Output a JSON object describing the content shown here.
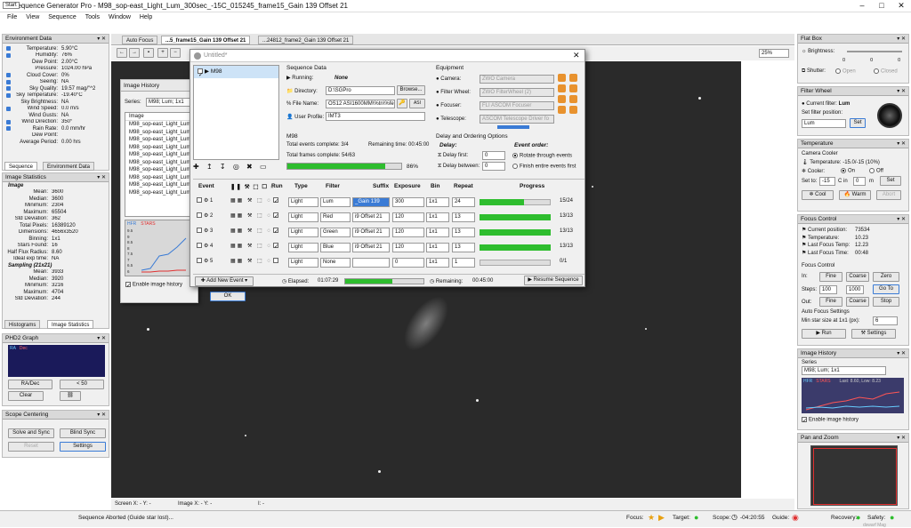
{
  "window": {
    "start_badge": "Start",
    "title": "Sequence Generator Pro - M98_sop-east_Light_Lum_300sec_-15C_015245_frame15_Gain 139 Offset 21"
  },
  "menu": [
    "File",
    "View",
    "Sequence",
    "Tools",
    "Window",
    "Help"
  ],
  "tabs": [
    "Auto Focus",
    "...5_frame15_Gain 139 Offset 21",
    "...24812_frame2_Gain 139 Offset 21"
  ],
  "zoom": "25%",
  "environment": {
    "title": "Environment Data",
    "rows": [
      {
        "label": "Temperature:",
        "value": "5.90°C",
        "color": "#3a7bd5"
      },
      {
        "label": "Humidity:",
        "value": "76%",
        "color": "#3a7bd5"
      },
      {
        "label": "Dew Point:",
        "value": "2.00°C",
        "color": ""
      },
      {
        "label": "Pressure:",
        "value": "1024.00 hPa",
        "color": ""
      },
      {
        "label": "Cloud Cover:",
        "value": "0%",
        "color": "#3a7bd5"
      },
      {
        "label": "Seeing:",
        "value": "NA",
        "color": "#3a7bd5"
      },
      {
        "label": "Sky Quality:",
        "value": "19.57 mag/\"^2",
        "color": "#3a7bd5"
      },
      {
        "label": "Sky Temperature:",
        "value": "-19.40°C",
        "color": "#3a7bd5"
      },
      {
        "label": "Sky Brightness:",
        "value": "NA",
        "color": ""
      },
      {
        "label": "Wind Speed:",
        "value": "0.0 m/s",
        "color": "#3a7bd5"
      },
      {
        "label": "Wind Gusts:",
        "value": "NA",
        "color": ""
      },
      {
        "label": "Wind Direction:",
        "value": "350°",
        "color": "#3a7bd5"
      },
      {
        "label": "Rain Rate:",
        "value": "0.0 mm/hr",
        "color": "#3a7bd5"
      },
      {
        "label": "Dew Point:",
        "value": "",
        "color": ""
      },
      {
        "label": "Average Period:",
        "value": "0.00 hrs",
        "color": ""
      }
    ],
    "tab_sequence": "Sequence",
    "tab_env": "Environment Data"
  },
  "image_stats": {
    "title": "Image Statistics",
    "image_label": "Image",
    "rows": [
      {
        "label": "Mean:",
        "value": "3600"
      },
      {
        "label": "Median:",
        "value": "3600"
      },
      {
        "label": "Minimum:",
        "value": "2304"
      },
      {
        "label": "Maximum:",
        "value": "65504"
      },
      {
        "label": "Std Deviation:",
        "value": "362"
      },
      {
        "label": "Total Pixels:",
        "value": "16389120"
      },
      {
        "label": "Dimensions:",
        "value": "4656x3520"
      },
      {
        "label": "Binning:",
        "value": "1x1"
      },
      {
        "label": "Stars Found:",
        "value": "16"
      },
      {
        "label": "Half Flux Radius:",
        "value": "8.60"
      },
      {
        "label": "Ideal exp time:",
        "value": "NA"
      }
    ],
    "sampling_label": "Sampling (21x21)",
    "sampling": [
      {
        "label": "Mean:",
        "value": "3933"
      },
      {
        "label": "Median:",
        "value": "3920"
      },
      {
        "label": "Minimum:",
        "value": "3216"
      },
      {
        "label": "Maximum:",
        "value": "4704"
      },
      {
        "label": "Std Deviation:",
        "value": "244"
      }
    ],
    "tab_hist": "Histograms",
    "tab_stats": "Image Statistics"
  },
  "phd2": {
    "title": "PHD2 Graph",
    "legend_ra": "RA",
    "legend_dec": "Dec",
    "radec": "RA/Dec",
    "scale": "< 50",
    "clear": "Clear"
  },
  "centering": {
    "title": "Scope Centering",
    "solve": "Solve and Sync",
    "blind": "Blind Sync",
    "reset": "Reset",
    "settings": "Settings"
  },
  "image_history": {
    "title": "Image History",
    "series_label": "Series:",
    "series_value": "M98; Lum; 1x1",
    "col": "Image",
    "items": [
      "M98_sop-east_Light_Lum_",
      "M98_sop-east_Light_Lum_",
      "M98_sop-east_Light_Lum_",
      "M98_sop-east_Light_Lum_",
      "M98_sop-east_Light_Lum_",
      "M98_sop-east_Light_Lum_",
      "M98_sop-east_Light_Lum_",
      "M98_sop-east_Light_Lum_",
      "M98_sop-east_Light_Lum_",
      "M98_sop-east_Light_Lum_"
    ],
    "hfr": "HFR",
    "stars": "STARS",
    "yticks": [
      "9.5",
      "9",
      "8.5",
      "8",
      "7.5",
      "7",
      "6.5",
      "6"
    ],
    "enable": "Enable image history",
    "ok": "OK"
  },
  "sequence": {
    "title": "Untitled*",
    "target": "M98",
    "seq_data": "Sequence Data",
    "running_label": "Running:",
    "running_value": "None",
    "dir_label": "Directory:",
    "dir_value": "D:\\SGPro",
    "browse": "Browse...",
    "file_label": "File Name:",
    "file_value": "OS12 ASI1600MM\\%tn\\%fe\\",
    "profile_label": "User Profile:",
    "profile_value": "IMT3",
    "equip_label": "Equipment",
    "camera_label": "Camera:",
    "camera_value": "ZWO Camera",
    "fw_label": "Filter Wheel:",
    "fw_value": "ZWO FilterWheel (2)",
    "focuser_label": "Focuser:",
    "focuser_value": "FLI ASCOM Focuser",
    "telescope_label": "Telescope:",
    "telescope_value": "ASCOM Telescope Driver fo",
    "target_name": "M98",
    "events_complete": "Total events complete: 3/4",
    "remaining_time": "Remaining time: 00:45:00",
    "frames_complete": "Total frames complete: 54/63",
    "progress_pct": "86%",
    "progress_value": 0.86,
    "delay_section": "Delay and Ordering Options",
    "delay_label": "Delay:",
    "delay_first": "Delay first:",
    "delay_first_v": "0",
    "delay_between": "Delay between:",
    "delay_between_v": "0",
    "event_order": "Event order:",
    "rotate": "Rotate through events",
    "finish": "Finish entire events first",
    "headers": [
      "Event",
      "Run",
      "Type",
      "Filter",
      "Suffix",
      "Exposure",
      "Bin",
      "Repeat",
      "Progress"
    ],
    "events": [
      {
        "num": "1",
        "run": true,
        "type": "Light",
        "filter": "Lum",
        "suffix": "_Gain 139",
        "exposure": "300",
        "bin": "1x1",
        "repeat": "24",
        "progress": 0.625,
        "count": "15/24"
      },
      {
        "num": "2",
        "run": true,
        "type": "Light",
        "filter": "Red",
        "suffix": "i9 Offset 21",
        "exposure": "120",
        "bin": "1x1",
        "repeat": "13",
        "progress": 1,
        "count": "13/13"
      },
      {
        "num": "3",
        "run": true,
        "type": "Light",
        "filter": "Green",
        "suffix": "i9 Offset 21",
        "exposure": "120",
        "bin": "1x1",
        "repeat": "13",
        "progress": 1,
        "count": "13/13"
      },
      {
        "num": "4",
        "run": true,
        "type": "Light",
        "filter": "Blue",
        "suffix": "i9 Offset 21",
        "exposure": "120",
        "bin": "1x1",
        "repeat": "13",
        "progress": 1,
        "count": "13/13"
      },
      {
        "num": "5",
        "run": false,
        "type": "Light",
        "filter": "None",
        "suffix": "",
        "exposure": "0",
        "bin": "1x1",
        "repeat": "1",
        "progress": 0,
        "count": "0/1"
      }
    ],
    "add_event": "Add New Event",
    "elapsed_label": "Elapsed:",
    "elapsed": "01:07:29",
    "remaining_label": "Remaining:",
    "remaining": "00:45:00",
    "elapsed_progress": 0.6,
    "remaining_progress": 0,
    "resume": "Resume Sequence"
  },
  "flat_box": {
    "title": "Flat Box",
    "brightness": "Brightness:",
    "shutter": "Shutter:",
    "open": "Open",
    "closed": "Closed",
    "ticks": [
      "0",
      "0",
      "0"
    ]
  },
  "filter_wheel": {
    "title": "Filter Wheel",
    "current_label": "Current filter:",
    "current": "Lum",
    "set_label": "Set filter position:",
    "value": "Lum",
    "set": "Set"
  },
  "temperature": {
    "title": "Temperature",
    "cooler_label": "Camera Cooler",
    "temp_label": "Temperature:",
    "temp_value": "-15.0/-15 (10%)",
    "cooler": "Cooler:",
    "on": "On",
    "off": "Off",
    "set_to": "Set to:",
    "set_value": "-15",
    "cin": "C in",
    "cin_value": "0",
    "m": "m",
    "set": "Set",
    "cool": "Cool",
    "warm": "Warm",
    "abort": "Abort"
  },
  "focus_control": {
    "title": "Focus Control",
    "pos_label": "Current position:",
    "pos": "73534",
    "temp_label": "Temperature:",
    "temp": "10.23",
    "lft_label": "Last Focus Temp:",
    "lft": "12.23",
    "lftime_label": "Last Focus Time:",
    "lftime": "00:48",
    "section": "Focus Control",
    "in": "In:",
    "fine": "Fine",
    "coarse": "Coarse",
    "zero": "Zero",
    "steps": "Steps:",
    "s1": "100",
    "s2": "1000",
    "goto": "Go To",
    "out": "Out:",
    "stop": "Stop",
    "af_settings": "Auto Focus Settings",
    "min_star": "Min star size at 1x1 (px):",
    "min_star_v": "6",
    "run": "Run",
    "settings": "Settings"
  },
  "image_history_small": {
    "title": "Image History",
    "series": "Series",
    "series_value": "M98; Lum; 1x1",
    "hfr": "HFR",
    "stars": "STARS",
    "last": "Last: 8.60, Low: 8.23",
    "enable": "Enable image history"
  },
  "pan_zoom": {
    "title": "Pan and Zoom"
  },
  "status": {
    "screen": "Screen X: - Y: -",
    "image": "Image X: - Y: -",
    "i": "I: -",
    "message": "Sequence Aborted (Guide star lost)...",
    "focus": "Focus:",
    "target": "Target:",
    "scope": "Scope:",
    "scope_time": "-04:20:55",
    "guide": "Guide:",
    "recovery": "Recovery:",
    "safety": "Safety:",
    "watermark": "dswarf Mag"
  }
}
